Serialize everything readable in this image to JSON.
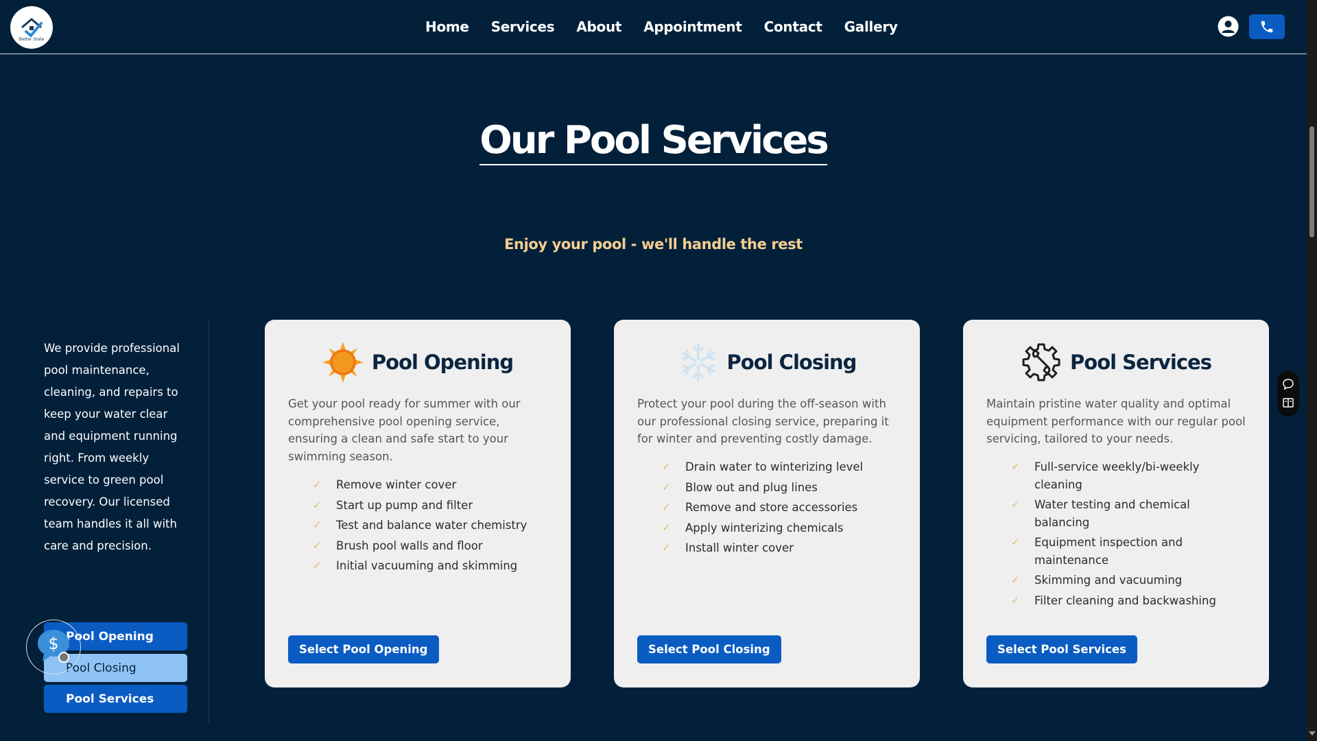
{
  "nav": {
    "logo_text": "Better State",
    "links": [
      "Home",
      "Services",
      "About",
      "Appointment",
      "Contact",
      "Gallery"
    ]
  },
  "hero": {
    "title": "Our Pool Services",
    "subtitle": "Enjoy your pool - we'll handle the rest"
  },
  "sidebar": {
    "intro": "We provide professional pool maintenance, cleaning, and repairs to keep your water clear and equipment running right. From weekly service to green pool recovery. Our licensed team handles it all with care and precision.",
    "buttons": [
      "Pool Opening",
      "Pool Closing",
      "Pool Services"
    ]
  },
  "cards": [
    {
      "title": "Pool Opening",
      "icon": "sun-icon",
      "description": "Get your pool ready for summer with our comprehensive pool opening service, ensuring a clean and safe start to your swimming season.",
      "features": [
        "Remove winter cover",
        "Start up pump and filter",
        "Test and balance water chemistry",
        "Brush pool walls and floor",
        "Initial vacuuming and skimming"
      ],
      "button": "Select Pool Opening"
    },
    {
      "title": "Pool Closing",
      "icon": "snowflake-icon",
      "description": "Protect your pool during the off-season with our professional closing service, preparing it for winter and preventing costly damage.",
      "features": [
        "Drain water to winterizing level",
        "Blow out and plug lines",
        "Remove and store accessories",
        "Apply winterizing chemicals",
        "Install winter cover"
      ],
      "button": "Select Pool Closing"
    },
    {
      "title": "Pool Services",
      "icon": "gear-wrench-icon",
      "description": "Maintain pristine water quality and optimal equipment performance with our regular pool servicing, tailored to your needs.",
      "features": [
        "Full-service weekly/bi-weekly cleaning",
        "Water testing and chemical balancing",
        "Equipment inspection and maintenance",
        "Skimming and vacuuming",
        "Filter cleaning and backwashing"
      ],
      "button": "Select Pool Services"
    }
  ],
  "colors": {
    "background": "#03203a",
    "accent": "#0a5cc2",
    "subtitle": "#f3cf8f",
    "check": "#e8b868",
    "card": "#efefef"
  }
}
